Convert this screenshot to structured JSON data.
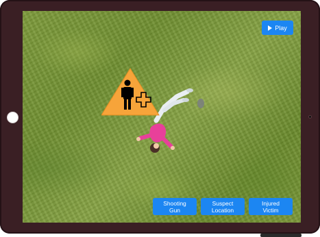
{
  "player": {
    "play_label": "Play",
    "play_icon": "play-icon"
  },
  "tags": [
    {
      "line1": "Shooting",
      "line2": "Gun"
    },
    {
      "line1": "Suspect",
      "line2": "Location"
    },
    {
      "line1": "Injured",
      "line2": "Victim"
    }
  ],
  "marker": {
    "icon": "injured-person-warning-icon",
    "color": "#f7a43a"
  },
  "colors": {
    "accent": "#1c86f2",
    "bezel": "#3a1f24"
  }
}
